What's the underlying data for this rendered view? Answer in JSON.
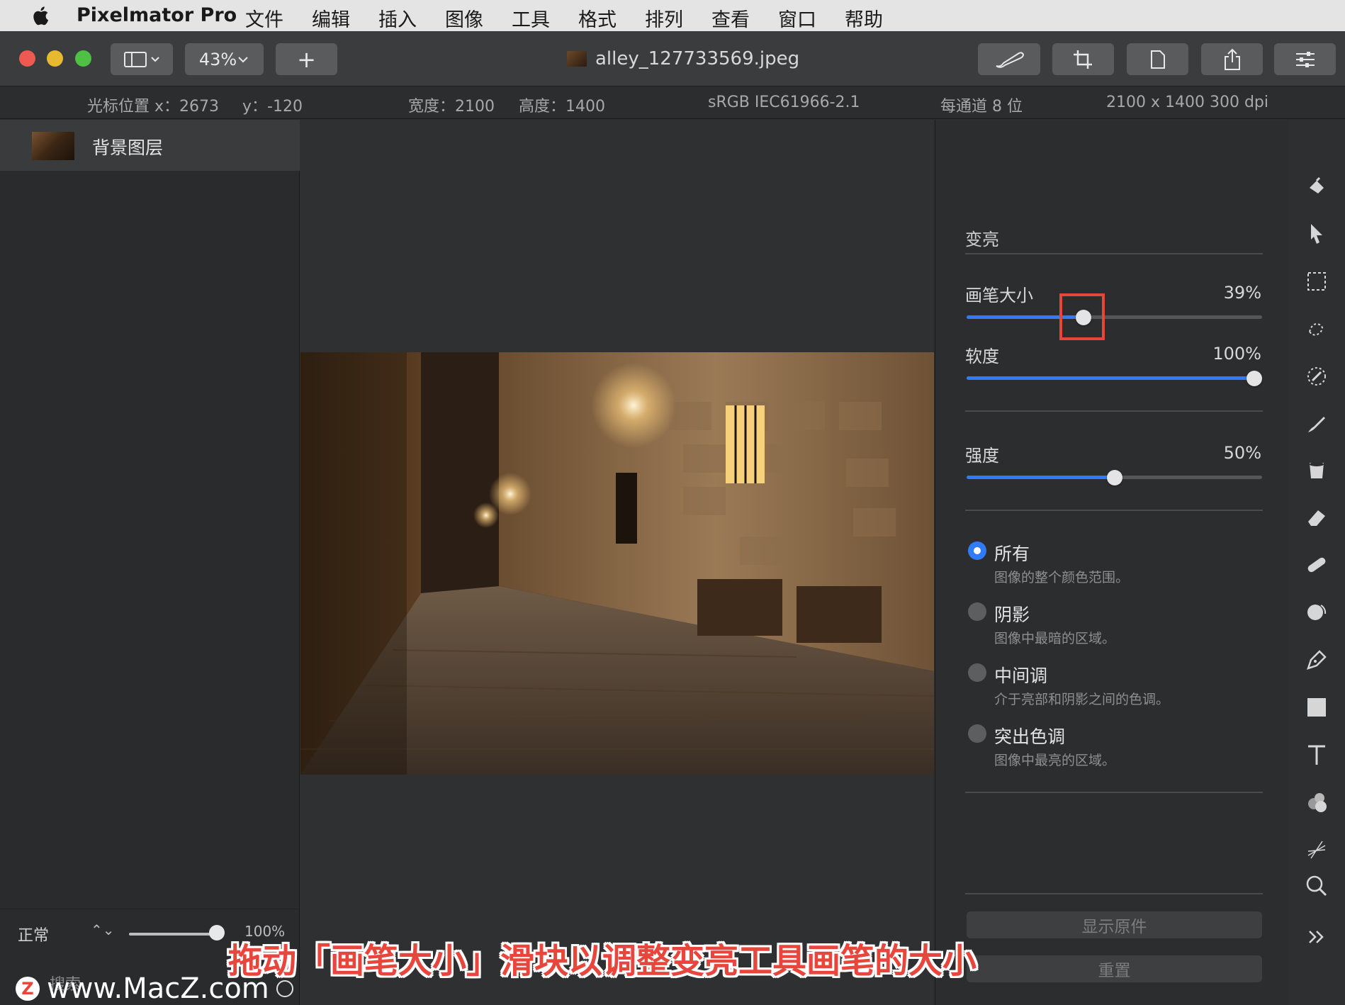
{
  "menubar": {
    "app_name": "Pixelmator Pro",
    "items": [
      "文件",
      "编辑",
      "插入",
      "图像",
      "工具",
      "格式",
      "排列",
      "查看",
      "窗口",
      "帮助"
    ]
  },
  "toolbar": {
    "zoom": "43%",
    "add": "+",
    "document_title": "alley_127733569.jpeg"
  },
  "infobar": {
    "cursor_x": "光标位置 x：2673",
    "cursor_y": "y：-120",
    "width": "宽度：2100",
    "height": "高度：1400",
    "color_profile": "sRGB IEC61966-2.1",
    "bit_depth": "每通道 8 位",
    "size_dpi": "2100 x 1400 300 dpi"
  },
  "layers": {
    "items": [
      {
        "name": "背景图层"
      }
    ],
    "blend_mode": "正常",
    "opacity": "100%",
    "search_placeholder": "搜索"
  },
  "panel": {
    "title": "变亮",
    "brush_size": {
      "label": "画笔大小",
      "value": "39%",
      "fraction": 0.39
    },
    "softness": {
      "label": "软度",
      "value": "100%",
      "fraction": 1.0
    },
    "strength": {
      "label": "强度",
      "value": "50%",
      "fraction": 0.5
    },
    "ranges": [
      {
        "label": "所有",
        "desc": "图像的整个颜色范围。",
        "selected": true
      },
      {
        "label": "阴影",
        "desc": "图像中最暗的区域。",
        "selected": false
      },
      {
        "label": "中间调",
        "desc": "介于亮部和阴影之间的色调。",
        "selected": false
      },
      {
        "label": "突出色调",
        "desc": "图像中最亮的区域。",
        "selected": false
      }
    ],
    "show_original": "显示原件",
    "reset": "重置"
  },
  "tools": [
    "paint-bucket-icon",
    "arrow-select-icon",
    "rect-select-icon",
    "quick-select-icon",
    "color-picker-icon",
    "paint-brush-icon",
    "fill-icon",
    "eraser-icon",
    "bandage-icon",
    "retouch-icon",
    "pen-icon",
    "shape-icon",
    "text-icon",
    "effects-icon",
    "distort-icon",
    "zoom-icon",
    "more-icon"
  ],
  "overlay": {
    "caption": "拖动「画笔大小」滑块以调整变亮工具画笔的大小",
    "watermark": "www.MacZ.com",
    "watermark_badge": "Z"
  },
  "colors": {
    "accent": "#2f7cf6",
    "highlight": "#e8463c"
  }
}
